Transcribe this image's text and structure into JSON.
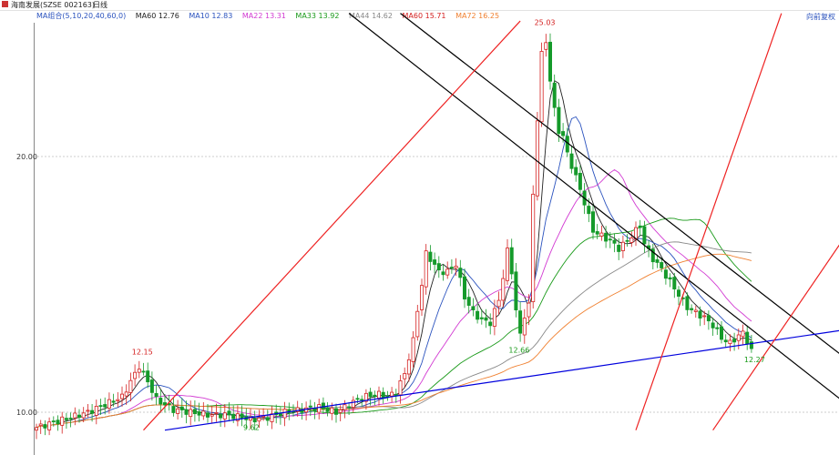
{
  "header": {
    "title": "海南发展(SZSE 002163)",
    "period": "日线",
    "right_link": "向前复权"
  },
  "legend": [
    {
      "label": "MA组合(5,10,20,40,60,0)",
      "color": "#2a52be"
    },
    {
      "label": "MA60 12.76",
      "color": "#222222"
    },
    {
      "label": "MA10 12.83",
      "color": "#2a52be"
    },
    {
      "label": "MA22 13.31",
      "color": "#d23ad2"
    },
    {
      "label": "MA33 13.92",
      "color": "#1a9a1a"
    },
    {
      "label": "MA44 14.62",
      "color": "#888888"
    },
    {
      "label": "MA60 15.71",
      "color": "#d42020"
    },
    {
      "label": "MA72 16.25",
      "color": "#f08030"
    }
  ],
  "chart_data": {
    "type": "candlestick",
    "y_ticks": [
      "20.00",
      "10.00"
    ],
    "ylim": [
      9.3,
      25.6
    ],
    "annotations": [
      {
        "text": "25.03",
        "index": 118,
        "value": 25.03,
        "color": "#d42020"
      },
      {
        "text": "12.15",
        "index": 24,
        "value": 12.15,
        "color": "#d42020"
      },
      {
        "text": "9.62",
        "index": 50,
        "value": 9.62,
        "color": "#1a9a1a"
      },
      {
        "text": "12.66",
        "index": 112,
        "value": 12.66,
        "color": "#1a9a1a"
      },
      {
        "text": "12.27",
        "index": 167,
        "value": 12.27,
        "color": "#1a9a1a"
      }
    ],
    "trendlines": [
      {
        "color": "#000000",
        "from": [
          73,
          25.6
        ],
        "to": [
          200,
          8.9
        ]
      },
      {
        "color": "#000000",
        "from": [
          85,
          25.6
        ],
        "to": [
          206,
          9.9
        ]
      },
      {
        "color": "#0000dd",
        "from": [
          30,
          9.3
        ],
        "to": [
          200,
          13.5
        ]
      },
      {
        "color": "#ee2222",
        "from": [
          25,
          9.3
        ],
        "to": [
          113,
          25.3
        ]
      },
      {
        "color": "#ee2222",
        "from": [
          140,
          9.3
        ],
        "to": [
          174,
          25.6
        ]
      },
      {
        "color": "#ee2222",
        "from": [
          158,
          9.3
        ],
        "to": [
          200,
          19.6
        ]
      }
    ]
  }
}
